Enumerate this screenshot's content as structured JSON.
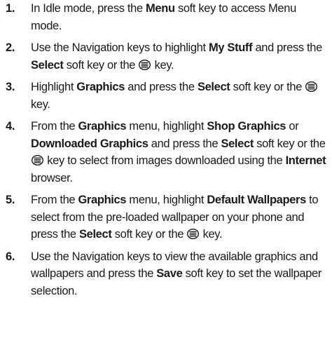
{
  "steps": [
    {
      "number": "1.",
      "parts": [
        {
          "t": "In Idle mode, press the "
        },
        {
          "t": "Menu",
          "b": true
        },
        {
          "t": " soft key to access Menu mode."
        }
      ]
    },
    {
      "number": "2.",
      "parts": [
        {
          "t": "Use the Navigation keys to highlight "
        },
        {
          "t": "My Stuff",
          "b": true
        },
        {
          "t": " and press the "
        },
        {
          "t": "Select",
          "b": true
        },
        {
          "t": " soft key or the "
        },
        {
          "icon": "ok-key-icon"
        },
        {
          "t": " key."
        }
      ]
    },
    {
      "number": "3.",
      "parts": [
        {
          "t": "Highlight "
        },
        {
          "t": "Graphics",
          "b": true
        },
        {
          "t": " and press the "
        },
        {
          "t": "Select",
          "b": true
        },
        {
          "t": " soft key or the "
        },
        {
          "icon": "ok-key-icon"
        },
        {
          "t": " key."
        }
      ]
    },
    {
      "number": "4.",
      "parts": [
        {
          "t": "From the "
        },
        {
          "t": "Graphics",
          "b": true
        },
        {
          "t": " menu, highlight "
        },
        {
          "t": "Shop Graphics",
          "b": true
        },
        {
          "t": " or "
        },
        {
          "t": "Downloaded Graphics",
          "b": true
        },
        {
          "t": " and press the "
        },
        {
          "t": "Select",
          "b": true
        },
        {
          "t": " soft key or the "
        },
        {
          "icon": "ok-key-icon"
        },
        {
          "t": " key to select from images downloaded using the "
        },
        {
          "t": "Internet",
          "b": true
        },
        {
          "t": " browser."
        }
      ]
    },
    {
      "number": "5.",
      "parts": [
        {
          "t": "From the "
        },
        {
          "t": "Graphics",
          "b": true
        },
        {
          "t": " menu, highlight "
        },
        {
          "t": "Default Wallpapers",
          "b": true
        },
        {
          "t": " to select from the pre-loaded wallpaper on your phone and press the "
        },
        {
          "t": "Select",
          "b": true
        },
        {
          "t": " soft key or the "
        },
        {
          "icon": "ok-key-icon"
        },
        {
          "t": " key."
        }
      ]
    },
    {
      "number": "6.",
      "parts": [
        {
          "t": "Use the Navigation keys to view the available graphics and wallpapers and press the "
        },
        {
          "t": "Save",
          "b": true
        },
        {
          "t": " soft key to set the wallpaper selection."
        }
      ]
    }
  ]
}
